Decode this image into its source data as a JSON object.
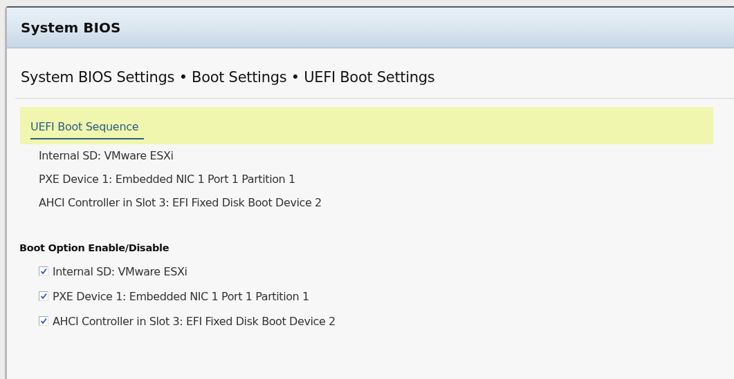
{
  "window": {
    "title": "System BIOS"
  },
  "breadcrumb": "System BIOS Settings • Boot Settings • UEFI Boot Settings",
  "boot_sequence": {
    "label": "UEFI Boot Sequence",
    "selected": true,
    "items": [
      "Internal SD: VMware ESXi",
      "PXE Device 1: Embedded NIC 1 Port 1 Partition 1",
      "AHCI Controller in Slot 3: EFI Fixed Disk Boot Device 2"
    ]
  },
  "boot_options": {
    "heading": "Boot Option Enable/Disable",
    "items": [
      {
        "label": "Internal SD: VMware ESXi",
        "checked": true
      },
      {
        "label": "PXE Device 1: Embedded NIC 1 Port 1 Partition 1",
        "checked": true
      },
      {
        "label": "AHCI Controller in Slot 3: EFI Fixed Disk Boot Device 2",
        "checked": true
      }
    ]
  }
}
